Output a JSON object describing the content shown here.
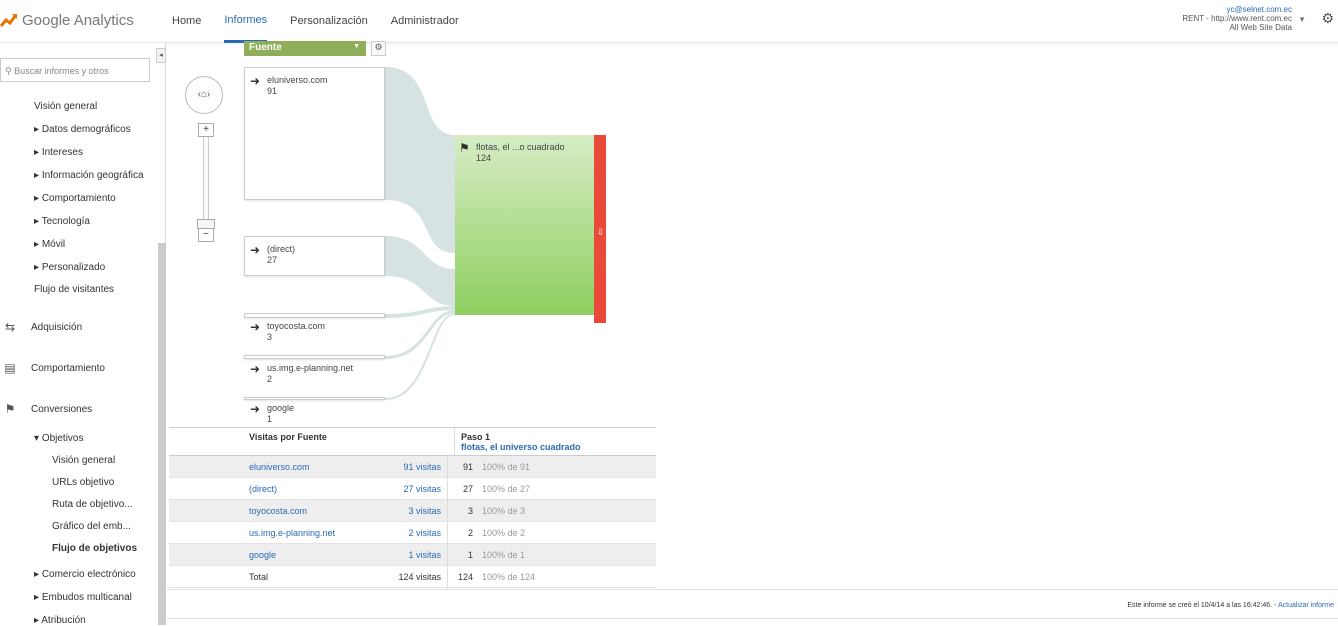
{
  "header": {
    "logo_text": "Google Analytics",
    "nav": [
      "Home",
      "Informes",
      "Personalización",
      "Administrador"
    ],
    "account": {
      "email": "yc@selnet.com.ec",
      "property": "RENT - http://www.rent.com.ec",
      "view": "All Web Site Data"
    }
  },
  "sidebar": {
    "search_placeholder": "Buscar informes y otros",
    "audience_items": [
      "Visión general",
      "Datos demográficos",
      "Intereses",
      "Información geográfica",
      "Comportamiento",
      "Tecnología",
      "Móvil",
      "Personalizado",
      "Flujo de visitantes"
    ],
    "sections": [
      "Adquisición",
      "Comportamiento",
      "Conversiones"
    ],
    "objetivos": "Objetivos",
    "objetivos_items": [
      "Visión general",
      "URLs objetivo",
      "Ruta de objetivo...",
      "Gráfico del emb...",
      "Flujo de objetivos"
    ],
    "bottom_items": [
      "Comercio electrónico",
      "Embudos multicanal",
      "Atribución"
    ]
  },
  "flow": {
    "dimension": "Fuente",
    "sources": [
      {
        "name": "eluniverso.com",
        "value": "91"
      },
      {
        "name": "(direct)",
        "value": "27"
      },
      {
        "name": "toyocosta.com",
        "value": "3"
      },
      {
        "name": "us.img.e-planning.net",
        "value": "2"
      },
      {
        "name": "google",
        "value": "1"
      }
    ],
    "goal": {
      "name": "flotas, el ...o cuadrado",
      "value": "124"
    }
  },
  "table": {
    "header_col1": "Visitas por Fuente",
    "header_step": "Paso 1",
    "header_goal": "flotas, el universo cuadrado",
    "rows": [
      {
        "source": "eluniverso.com",
        "visits": "91 visitas",
        "count": "91",
        "pct": "100% de 91"
      },
      {
        "source": "(direct)",
        "visits": "27 visitas",
        "count": "27",
        "pct": "100% de 27"
      },
      {
        "source": "toyocosta.com",
        "visits": "3 visitas",
        "count": "3",
        "pct": "100% de 3"
      },
      {
        "source": "us.img.e-planning.net",
        "visits": "2 visitas",
        "count": "2",
        "pct": "100% de 2"
      },
      {
        "source": "google",
        "visits": "1 visitas",
        "count": "1",
        "pct": "100% de 1"
      }
    ],
    "total": {
      "label": "Total",
      "visits": "124 visitas",
      "count": "124",
      "pct": "100% de 124"
    }
  },
  "footer": {
    "text": "Este informe se creó el 10/4/14 a las 16:42:46. -",
    "link": "Actualizar informe"
  }
}
